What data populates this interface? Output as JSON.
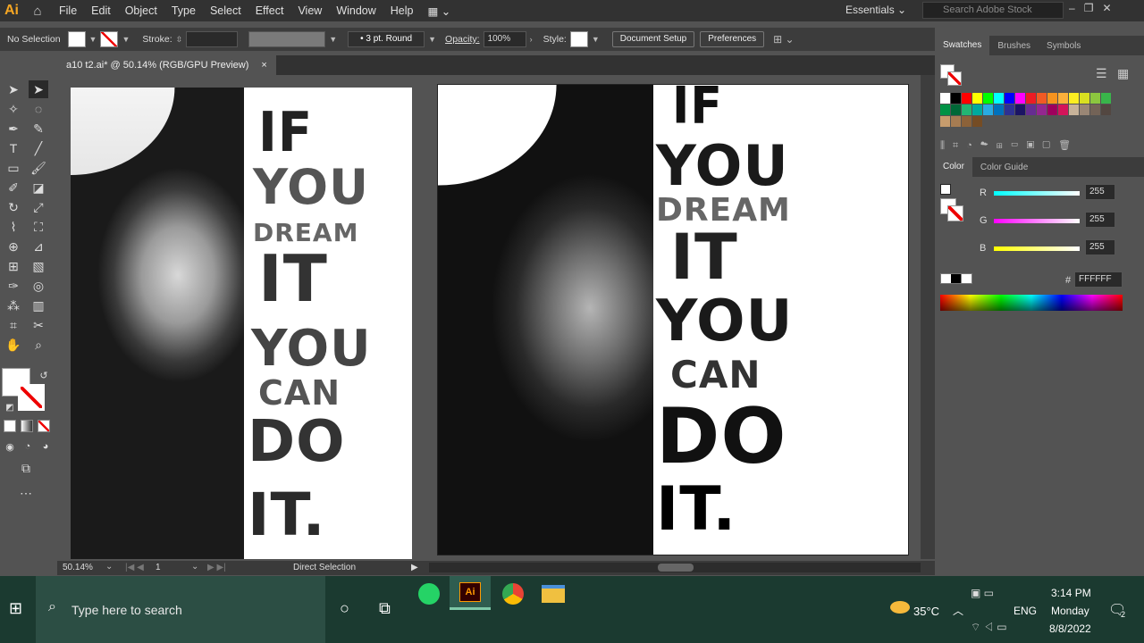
{
  "menubar": {
    "logo": "Ai",
    "items": [
      "File",
      "Edit",
      "Object",
      "Type",
      "Select",
      "Effect",
      "View",
      "Window",
      "Help"
    ],
    "workspace": "Essentials",
    "search_placeholder": "Search Adobe Stock"
  },
  "control_bar": {
    "selection": "No Selection",
    "stroke_label": "Stroke:",
    "brush": "3 pt. Round",
    "opacity_label": "Opacity:",
    "opacity_value": "100%",
    "style_label": "Style:",
    "doc_setup": "Document Setup",
    "preferences": "Preferences"
  },
  "document_tab": {
    "title": "a10 t2.ai* @ 50.14% (RGB/GPU Preview)",
    "close": "×"
  },
  "status_bar": {
    "zoom": "50.14%",
    "artboard": "1",
    "tool": "Direct Selection"
  },
  "panels": {
    "top_tabs": [
      "Swatches",
      "Brushes",
      "Symbols"
    ],
    "color_tabs": [
      "Color",
      "Color Guide"
    ],
    "r_label": "R",
    "r_value": "255",
    "g_label": "G",
    "g_value": "255",
    "b_label": "B",
    "b_value": "255",
    "hex_label": "#",
    "hex_value": "FFFFFF"
  },
  "artboard_left": {
    "lines": [
      "IF",
      "YOU",
      "DREAM",
      "IT",
      "YOU",
      "CAN",
      "DO",
      "IT."
    ]
  },
  "artboard_right": {
    "lines": [
      "IF",
      "YOU",
      "DREAM",
      "IT",
      "YOU",
      "CAN",
      "DO",
      "IT."
    ]
  },
  "taskbar": {
    "search_placeholder": "Type here to search",
    "weather": "35°C",
    "lang": "ENG",
    "time": "3:14 PM",
    "day": "Monday",
    "date": "8/8/2022",
    "notif_count": "2"
  },
  "swatch_colors": [
    "#ffffff",
    "#000000",
    "#ff0000",
    "#ffff00",
    "#00ff00",
    "#00ffff",
    "#0000ff",
    "#ff00ff",
    "#ed1c24",
    "#f15a24",
    "#f7931e",
    "#fbb03b",
    "#fcee21",
    "#d9e021",
    "#8cc63f",
    "#39b54a",
    "#009245",
    "#006837",
    "#22b573",
    "#00a99d",
    "#29abe2",
    "#0071bc",
    "#2e3192",
    "#1b1464",
    "#662d91",
    "#93278f",
    "#9e005d",
    "#d4145a",
    "#c7b299",
    "#998675",
    "#736357",
    "#534741",
    "#c69c6d",
    "#a67c52",
    "#8c6239",
    "#754c24"
  ]
}
